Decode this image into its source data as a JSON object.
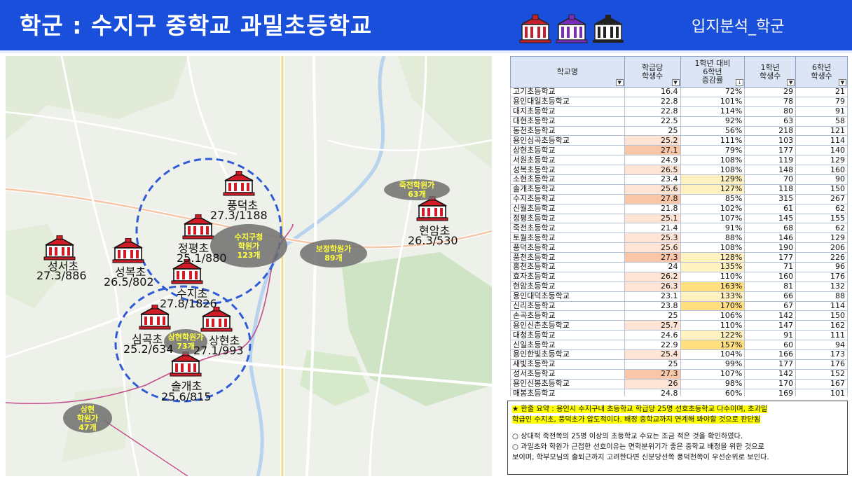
{
  "header": {
    "title": "학군 : 수지구 중학교 과밀초등학교",
    "right_label": "입지분석_학군",
    "bg_color": "#1a4fdc"
  },
  "map": {
    "schools": [
      {
        "name": "성서초",
        "value": "27.3/886"
      },
      {
        "name": "성복초",
        "value": "26.5/802"
      },
      {
        "name": "정평초",
        "value": "25.1/880"
      },
      {
        "name": "풍덕초",
        "value": "27.3/1188"
      },
      {
        "name": "수지초",
        "value": "27.8/1826"
      },
      {
        "name": "심곡초",
        "value": "25.2/634"
      },
      {
        "name": "상현초",
        "value": "27.1/993"
      },
      {
        "name": "솔개초",
        "value": "25.6/815"
      },
      {
        "name": "현암초",
        "value": "26.3/530"
      }
    ],
    "bubbles": [
      {
        "line1": "수지구청",
        "line2": "학원가",
        "line3": "123개"
      },
      {
        "line1": "보정학원가",
        "line2": "89개",
        "line3": ""
      },
      {
        "line1": "죽전학원가",
        "line2": "63개",
        "line3": ""
      },
      {
        "line1": "상현학원가",
        "line2": "73개",
        "line3": ""
      },
      {
        "line1": "상현",
        "line2": "학원가",
        "line3": "47개"
      }
    ]
  },
  "table": {
    "headers": {
      "name": "학교명",
      "c1a": "학급당",
      "c1b": "학생수",
      "c2a": "1학년 대비",
      "c2b": "6학년",
      "c2c": "증감률",
      "c3a": "1학년",
      "c3b": "학생수",
      "c4a": "6학년",
      "c4b": "학생수"
    },
    "rows": [
      {
        "name": "고기초등학교",
        "per": "16.4",
        "rate": "72%",
        "g1": "29",
        "g6": "21",
        "hp": "",
        "hr": ""
      },
      {
        "name": "용인대일초등학교",
        "per": "22.8",
        "rate": "101%",
        "g1": "78",
        "g6": "79",
        "hp": "",
        "hr": ""
      },
      {
        "name": "대지초등학교",
        "per": "22.8",
        "rate": "114%",
        "g1": "80",
        "g6": "91",
        "hp": "",
        "hr": ""
      },
      {
        "name": "대현초등학교",
        "per": "22.5",
        "rate": "92%",
        "g1": "63",
        "g6": "58",
        "hp": "",
        "hr": ""
      },
      {
        "name": "동천초등학교",
        "per": "25",
        "rate": "56%",
        "g1": "218",
        "g6": "121",
        "hp": "",
        "hr": ""
      },
      {
        "name": "용인심곡초등학교",
        "per": "25.2",
        "rate": "111%",
        "g1": "103",
        "g6": "114",
        "hp": "l",
        "hr": ""
      },
      {
        "name": "상현초등학교",
        "per": "27.1",
        "rate": "79%",
        "g1": "177",
        "g6": "140",
        "hp": "m",
        "hr": ""
      },
      {
        "name": "서원초등학교",
        "per": "24.9",
        "rate": "108%",
        "g1": "119",
        "g6": "129",
        "hp": "",
        "hr": ""
      },
      {
        "name": "성복초등학교",
        "per": "26.5",
        "rate": "108%",
        "g1": "148",
        "g6": "160",
        "hp": "l",
        "hr": ""
      },
      {
        "name": "소현초등학교",
        "per": "23.4",
        "rate": "129%",
        "g1": "70",
        "g6": "90",
        "hp": "",
        "hr": "l"
      },
      {
        "name": "솔개초등학교",
        "per": "25.6",
        "rate": "127%",
        "g1": "118",
        "g6": "150",
        "hp": "l",
        "hr": "l"
      },
      {
        "name": "수지초등학교",
        "per": "27.8",
        "rate": "85%",
        "g1": "315",
        "g6": "267",
        "hp": "m",
        "hr": ""
      },
      {
        "name": "신월초등학교",
        "per": "21.8",
        "rate": "102%",
        "g1": "61",
        "g6": "62",
        "hp": "",
        "hr": ""
      },
      {
        "name": "정평초등학교",
        "per": "25.1",
        "rate": "107%",
        "g1": "145",
        "g6": "155",
        "hp": "l",
        "hr": ""
      },
      {
        "name": "죽전초등학교",
        "per": "21.4",
        "rate": "91%",
        "g1": "68",
        "g6": "62",
        "hp": "",
        "hr": ""
      },
      {
        "name": "토월초등학교",
        "per": "25.3",
        "rate": "88%",
        "g1": "146",
        "g6": "129",
        "hp": "l",
        "hr": ""
      },
      {
        "name": "풍덕초등학교",
        "per": "25.6",
        "rate": "108%",
        "g1": "190",
        "g6": "206",
        "hp": "l",
        "hr": ""
      },
      {
        "name": "풍천초등학교",
        "per": "27.3",
        "rate": "128%",
        "g1": "177",
        "g6": "226",
        "hp": "m",
        "hr": "l"
      },
      {
        "name": "홍천초등학교",
        "per": "24",
        "rate": "135%",
        "g1": "71",
        "g6": "96",
        "hp": "",
        "hr": "l"
      },
      {
        "name": "효자초등학교",
        "per": "26.2",
        "rate": "110%",
        "g1": "160",
        "g6": "176",
        "hp": "l",
        "hr": ""
      },
      {
        "name": "현암초등학교",
        "per": "26.3",
        "rate": "163%",
        "g1": "81",
        "g6": "132",
        "hp": "l",
        "hr": "m"
      },
      {
        "name": "용인대덕초등학교",
        "per": "23.1",
        "rate": "133%",
        "g1": "66",
        "g6": "88",
        "hp": "",
        "hr": "l"
      },
      {
        "name": "신리초등학교",
        "per": "23.8",
        "rate": "170%",
        "g1": "67",
        "g6": "114",
        "hp": "",
        "hr": "m"
      },
      {
        "name": "손곡초등학교",
        "per": "25",
        "rate": "106%",
        "g1": "142",
        "g6": "150",
        "hp": "",
        "hr": ""
      },
      {
        "name": "용인신촌초등학교",
        "per": "25.7",
        "rate": "110%",
        "g1": "147",
        "g6": "162",
        "hp": "l",
        "hr": ""
      },
      {
        "name": "대청초등학교",
        "per": "24.6",
        "rate": "122%",
        "g1": "91",
        "g6": "111",
        "hp": "",
        "hr": "l"
      },
      {
        "name": "신일초등학교",
        "per": "22.9",
        "rate": "157%",
        "g1": "60",
        "g6": "94",
        "hp": "",
        "hr": "m"
      },
      {
        "name": "용인한빛초등학교",
        "per": "25.4",
        "rate": "104%",
        "g1": "166",
        "g6": "173",
        "hp": "l",
        "hr": ""
      },
      {
        "name": "새빛초등학교",
        "per": "25",
        "rate": "99%",
        "g1": "177",
        "g6": "176",
        "hp": "",
        "hr": ""
      },
      {
        "name": "성서초등학교",
        "per": "27.3",
        "rate": "107%",
        "g1": "142",
        "g6": "152",
        "hp": "m",
        "hr": ""
      },
      {
        "name": "용인신봉초등학교",
        "per": "26",
        "rate": "98%",
        "g1": "170",
        "g6": "167",
        "hp": "l",
        "hr": ""
      },
      {
        "name": "매봉초등학교",
        "per": "24.8",
        "rate": "60%",
        "g1": "169",
        "g6": "101",
        "hp": "",
        "hr": ""
      }
    ],
    "colors": {
      "per_light": "#fde4d4",
      "per_mid": "#f9c7a8",
      "rate_light": "#fff2c0",
      "rate_mid": "#ffdf80"
    }
  },
  "summary": {
    "line1": "★ 한줄 요약 : 용인시 수지구내 초등학교 학급당 25명 선호초등학교 다수이며, 초과밀",
    "line2": "학급인 수지초, 풍덕초가 압도적이다. 배정 중학교까지 연계해 봐야할 것으로 판단됨",
    "p1": "○ 상대적 죽전쪽의 25명 이상의 초등학교 수요는 조금 적은 것을 확인하였다.",
    "p2a": "○ 과밀초와 학원가 근접한 선호이유는 면학분위기가  좋은 중학교 배정을 위한 것으로",
    "p2b": "보이며, 학부모님의 출퇴근까지 고려한다면 신분당선쪽 풍덕천쪽이 우선순위로 보인다."
  }
}
